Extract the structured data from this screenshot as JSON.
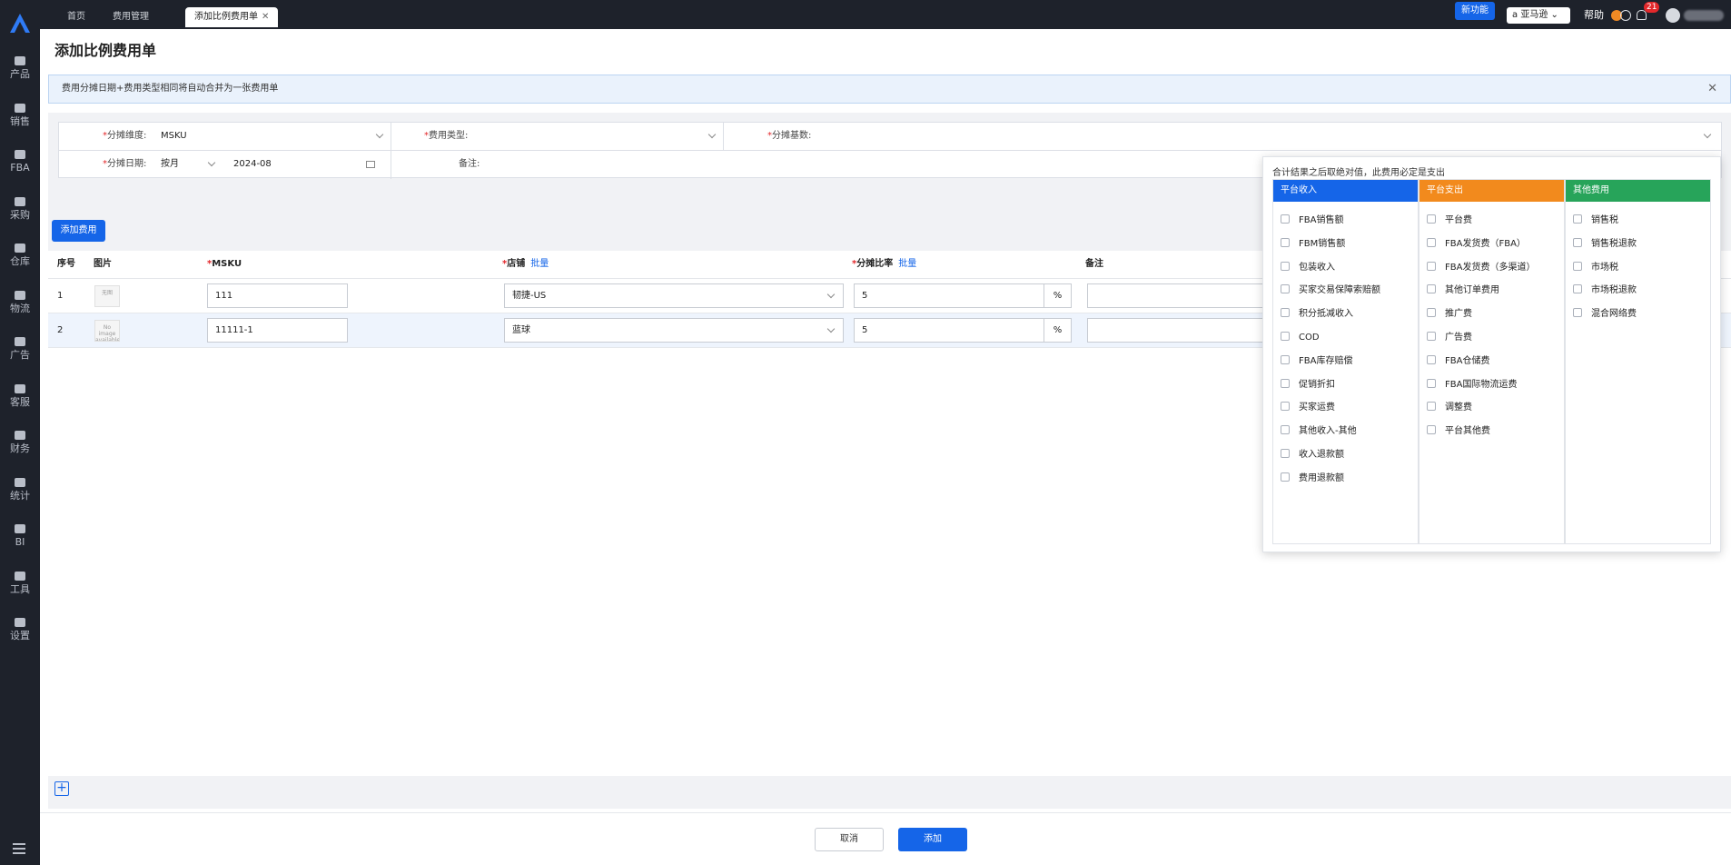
{
  "nav": {
    "items": [
      {
        "label": "产品",
        "icon": "box-icon"
      },
      {
        "label": "销售",
        "icon": "bag-icon"
      },
      {
        "label": "FBA",
        "icon": "fba-icon"
      },
      {
        "label": "采购",
        "icon": "cart-icon"
      },
      {
        "label": "仓库",
        "icon": "warehouse-icon"
      },
      {
        "label": "物流",
        "icon": "truck-icon"
      },
      {
        "label": "广告",
        "icon": "ad-icon"
      },
      {
        "label": "客服",
        "icon": "mail-icon"
      },
      {
        "label": "财务",
        "icon": "finance-icon"
      },
      {
        "label": "统计",
        "icon": "pie-icon"
      },
      {
        "label": "BI",
        "icon": "bi-icon"
      },
      {
        "label": "工具",
        "icon": "tool-icon"
      },
      {
        "label": "设置",
        "icon": "gear-icon"
      }
    ]
  },
  "topbar": {
    "tabs": [
      {
        "label": "首页"
      },
      {
        "label": "费用管理"
      },
      {
        "label": "添加比例费用单",
        "active": true
      }
    ],
    "new_feature": "新功能",
    "store_select": "亚马逊",
    "help": "帮助",
    "notification_count": "21"
  },
  "page": {
    "title": "添加比例费用单",
    "alert": "费用分摊日期+费用类型相同将自动合并为一张费用单"
  },
  "form": {
    "dimension_label": "分摊维度:",
    "dimension_value": "MSKU",
    "fee_type_label": "费用类型:",
    "base_label": "分摊基数:",
    "date_label": "分摊日期:",
    "date_mode": "按月",
    "date_value": "2024-08",
    "remark_label": "备注:"
  },
  "toolbar": {
    "add_fee": "添加费用"
  },
  "table": {
    "headers": {
      "index": "序号",
      "image": "图片",
      "msku": "MSKU",
      "store": "店铺",
      "store_batch": "批量",
      "ratio": "分摊比率",
      "ratio_batch": "批量",
      "remark": "备注"
    },
    "rows": [
      {
        "index": "1",
        "thumb": "无图",
        "msku": "111",
        "store": "韧捷-US",
        "ratio": "5",
        "unit": "%"
      },
      {
        "index": "2",
        "thumb": "No image available",
        "msku": "11111-1",
        "store": "蓝球",
        "ratio": "5",
        "unit": "%"
      }
    ]
  },
  "footer": {
    "cancel": "取消",
    "submit": "添加"
  },
  "popover": {
    "tip": "合计结果之后取绝对值，此费用必定是支出",
    "columns": [
      {
        "title": "平台收入",
        "color": "#1565e8",
        "options": [
          "FBA销售额",
          "FBM销售额",
          "包装收入",
          "买家交易保障索赔额",
          "积分抵减收入",
          "COD",
          "FBA库存赔偿",
          "促销折扣",
          "买家运费",
          "其他收入-其他",
          "收入退款额",
          "费用退款额"
        ]
      },
      {
        "title": "平台支出",
        "color": "#f28a1d",
        "options": [
          "平台费",
          "FBA发货费（FBA）",
          "FBA发货费（多渠道）",
          "其他订单费用",
          "推广费",
          "广告费",
          "FBA仓储费",
          "FBA国际物流运费",
          "调整费",
          "平台其他费"
        ]
      },
      {
        "title": "其他费用",
        "color": "#27a45a",
        "options": [
          "销售税",
          "销售税退款",
          "市场税",
          "市场税退款",
          "混合网络费"
        ]
      }
    ]
  }
}
